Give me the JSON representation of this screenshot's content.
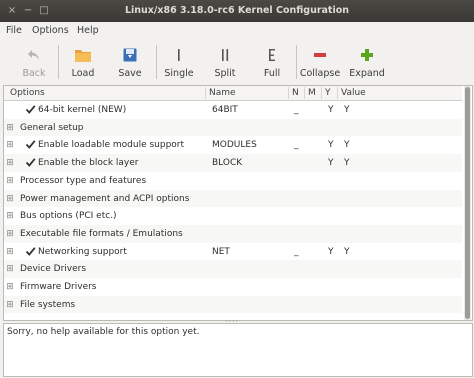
{
  "window": {
    "title": "Linux/x86 3.18.0-rc6 Kernel Configuration",
    "close_glyph": "×",
    "minimize_glyph": "−",
    "maximize_glyph": "□"
  },
  "menubar": {
    "items": [
      "File",
      "Options",
      "Help"
    ]
  },
  "toolbar": {
    "back": "Back",
    "load": "Load",
    "save": "Save",
    "single": "Single",
    "split": "Split",
    "full": "Full",
    "collapse": "Collapse",
    "expand": "Expand",
    "collapse_color": "#d63a3a",
    "expand_color": "#5aa51e",
    "accent": "#3b6fb6"
  },
  "list": {
    "columns": [
      "Options",
      "Name",
      "N",
      "M",
      "Y",
      "Value"
    ],
    "rows": [
      {
        "option": "64-bit kernel (NEW)",
        "name": "64BIT",
        "n": "_",
        "m": "",
        "y": "Y",
        "value": "Y",
        "checked": true,
        "expandable": false
      },
      {
        "option": "General setup",
        "name": "",
        "n": "",
        "m": "",
        "y": "",
        "value": "",
        "checked": false,
        "expandable": true
      },
      {
        "option": "Enable loadable module support",
        "name": "MODULES",
        "n": "_",
        "m": "",
        "y": "Y",
        "value": "Y",
        "checked": true,
        "expandable": true
      },
      {
        "option": "Enable the block layer",
        "name": "BLOCK",
        "n": "",
        "m": "",
        "y": "Y",
        "value": "Y",
        "checked": true,
        "expandable": true
      },
      {
        "option": "Processor type and features",
        "name": "",
        "n": "",
        "m": "",
        "y": "",
        "value": "",
        "checked": false,
        "expandable": true
      },
      {
        "option": "Power management and ACPI options",
        "name": "",
        "n": "",
        "m": "",
        "y": "",
        "value": "",
        "checked": false,
        "expandable": true
      },
      {
        "option": "Bus options (PCI etc.)",
        "name": "",
        "n": "",
        "m": "",
        "y": "",
        "value": "",
        "checked": false,
        "expandable": true
      },
      {
        "option": "Executable file formats / Emulations",
        "name": "",
        "n": "",
        "m": "",
        "y": "",
        "value": "",
        "checked": false,
        "expandable": true
      },
      {
        "option": "Networking support",
        "name": "NET",
        "n": "_",
        "m": "",
        "y": "Y",
        "value": "Y",
        "checked": true,
        "expandable": true
      },
      {
        "option": "Device Drivers",
        "name": "",
        "n": "",
        "m": "",
        "y": "",
        "value": "",
        "checked": false,
        "expandable": true
      },
      {
        "option": "Firmware Drivers",
        "name": "",
        "n": "",
        "m": "",
        "y": "",
        "value": "",
        "checked": false,
        "expandable": true
      },
      {
        "option": "File systems",
        "name": "",
        "n": "",
        "m": "",
        "y": "",
        "value": "",
        "checked": false,
        "expandable": true
      }
    ]
  },
  "help": {
    "text": "Sorry, no help available for this option yet."
  }
}
